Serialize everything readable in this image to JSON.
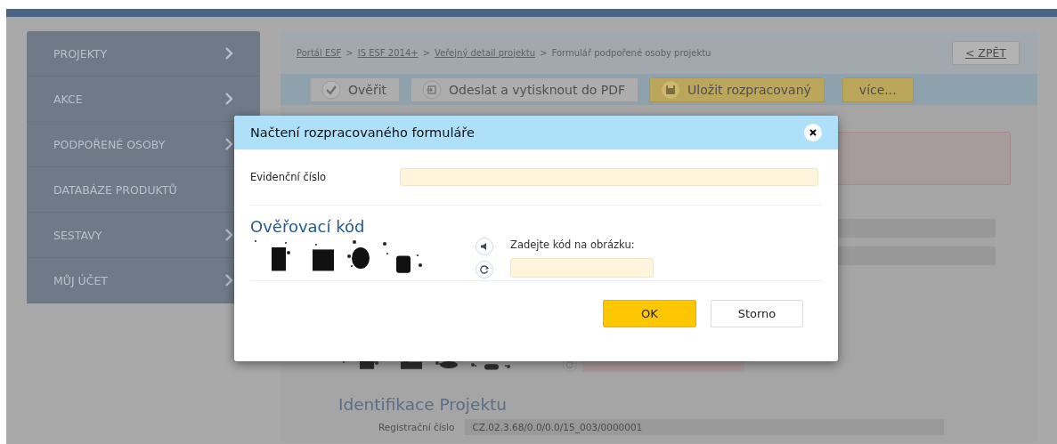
{
  "sidebar": {
    "items": [
      {
        "label": "PROJEKTY",
        "kind": "submenu"
      },
      {
        "label": "AKCE",
        "kind": "submenu"
      },
      {
        "label": "PODPOŘENÉ OSOBY",
        "kind": "submenu"
      },
      {
        "label": "DATABÁZE PRODUKTŮ",
        "kind": "link"
      },
      {
        "label": "SESTAVY",
        "kind": "submenu"
      },
      {
        "label": "MŮJ ÚČET",
        "kind": "submenu"
      }
    ]
  },
  "breadcrumb": {
    "separator": ">",
    "items": [
      {
        "label": "Portál ESF",
        "link": true
      },
      {
        "label": "IS ESF 2014+",
        "link": true
      },
      {
        "label": "Veřejný detail projektu",
        "link": true
      },
      {
        "label": "Formulář podpořené osoby projektu",
        "link": false
      }
    ],
    "back_button": "< ZPĚT"
  },
  "toolbar": [
    {
      "label": "Ověřit",
      "kind": "check"
    },
    {
      "label": "Odeslat a vytisknout do PDF",
      "kind": "send"
    },
    {
      "label": "Uložit rozpracovaný",
      "kind": "save"
    },
    {
      "label": "více...",
      "kind": "more"
    }
  ],
  "content": {
    "section_title": "Identifikace Projektu",
    "fields": [
      {
        "label": "Registrační číslo",
        "value": "CZ.02.3.68/0.0/0.0/15_003/0000001"
      }
    ]
  },
  "dialog": {
    "title": "Načtení rozpracovaného formuláře",
    "field": {
      "label": "Evidenční číslo"
    },
    "captcha": {
      "heading": "Ověřovací kód",
      "prompt": "Zadejte kód na obrázku:"
    },
    "buttons": [
      {
        "label": "OK",
        "kind": "primary"
      },
      {
        "label": "Storno",
        "kind": "secondary"
      }
    ]
  }
}
